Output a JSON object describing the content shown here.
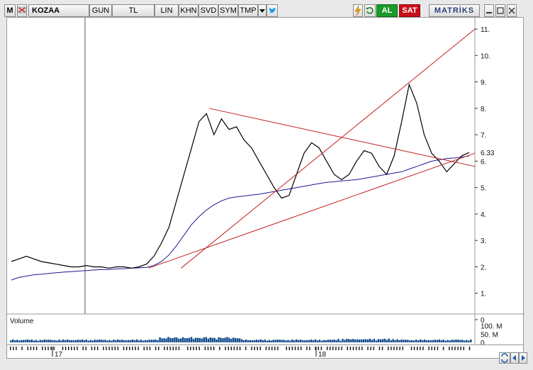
{
  "toolbar": {
    "menu_label": "M",
    "symbol": "KOZAA",
    "period": "GUN",
    "currency": "TL",
    "scale": "LIN",
    "buttons": [
      "KHN",
      "SVD",
      "SYM",
      "TMP"
    ],
    "dropdown_icon": "triangle-down",
    "twitter_icon": "bird",
    "lightning_icon": "lightning",
    "refresh_icon": "refresh",
    "buy_label": "AL",
    "sell_label": "SAT",
    "brand": "MATRİKS",
    "window_icons": [
      "minimize",
      "maximize",
      "close"
    ]
  },
  "colors": {
    "price": "#000000",
    "moving_average": "#1b1b8f",
    "trendline": "#c41e1e",
    "volume": "#0d4a8a",
    "buy": "#1a9a2a",
    "sell": "#c8101a"
  },
  "chart_data": {
    "type": "line",
    "symbol": "KOZAA",
    "y_ticks": [
      "0",
      "1.",
      "2.",
      "3.",
      "4.",
      "5.",
      "6.",
      "7.",
      "8.",
      "9.",
      "10.",
      "11."
    ],
    "ylim": [
      0,
      11
    ],
    "last_value_label": "6.33",
    "x_ticks": [
      "17",
      "18"
    ],
    "series": [
      {
        "values": [
          2.2,
          2.3,
          2.4,
          2.3,
          2.2,
          2.15,
          2.1,
          2.05,
          2.0,
          2.0,
          2.05,
          2.0,
          2.0,
          1.95,
          2.0,
          2.0,
          1.95,
          2.0,
          2.1,
          2.4,
          2.9,
          3.5,
          4.5,
          5.5,
          6.5,
          7.5,
          7.8,
          7.0,
          7.6,
          7.2,
          7.3,
          6.8,
          6.5,
          6.0,
          5.5,
          5.0,
          4.6,
          4.7,
          5.5,
          6.3,
          6.7,
          6.5,
          6.0,
          5.5,
          5.3,
          5.5,
          6.0,
          6.4,
          6.3,
          5.8,
          5.5,
          6.2,
          7.5,
          8.9,
          8.2,
          7.0,
          6.3,
          6.0,
          5.6,
          5.9,
          6.2,
          6.33
        ]
      },
      {
        "values": [
          1.5,
          1.6,
          1.65,
          1.7,
          1.72,
          1.75,
          1.78,
          1.8,
          1.82,
          1.84,
          1.86,
          1.88,
          1.9,
          1.9,
          1.92,
          1.93,
          1.95,
          1.96,
          1.98,
          2.05,
          2.2,
          2.45,
          2.8,
          3.2,
          3.6,
          3.9,
          4.15,
          4.35,
          4.5,
          4.6,
          4.65,
          4.68,
          4.72,
          4.75,
          4.8,
          4.85,
          4.9,
          4.95,
          5.0,
          5.05,
          5.1,
          5.15,
          5.2,
          5.22,
          5.25,
          5.28,
          5.3,
          5.35,
          5.4,
          5.45,
          5.5,
          5.55,
          5.6,
          5.7,
          5.8,
          5.9,
          6.0,
          6.05,
          6.1,
          6.12,
          6.15,
          6.2
        ]
      }
    ],
    "trendlines": [
      {
        "from": [
          0.37,
          1.95
        ],
        "to": [
          1.0,
          11.0
        ]
      },
      {
        "from": [
          0.43,
          8.0
        ],
        "to": [
          1.0,
          5.8
        ]
      },
      {
        "from": [
          0.3,
          1.95
        ],
        "to": [
          1.0,
          6.3
        ]
      }
    ],
    "volume": {
      "label": "Volume",
      "y_ticks": [
        "100. M",
        "50. M",
        "0"
      ],
      "ylim": [
        0,
        120
      ]
    }
  }
}
